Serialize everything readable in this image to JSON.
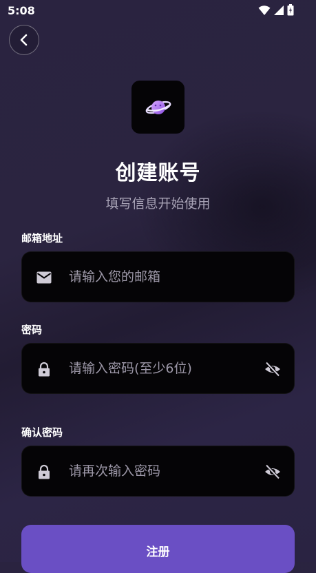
{
  "status_bar": {
    "time": "5:08"
  },
  "header": {
    "title": "创建账号",
    "subtitle": "填写信息开始使用"
  },
  "form": {
    "email": {
      "label": "邮箱地址",
      "placeholder": "请输入您的邮箱",
      "value": "",
      "icon": "mail-icon"
    },
    "password": {
      "label": "密码",
      "placeholder": "请输入密码(至少6位)",
      "value": "",
      "icon": "lock-icon",
      "toggle_icon": "eye-off-icon"
    },
    "confirm_password": {
      "label": "确认密码",
      "placeholder": "请再次输入密码",
      "value": "",
      "icon": "lock-icon",
      "toggle_icon": "eye-off-icon"
    }
  },
  "submit": {
    "label": "注册"
  },
  "colors": {
    "accent": "#6a4fc4",
    "field_bg": "#050406",
    "placeholder": "#9d98a8",
    "subtitle": "#a8a3b6"
  }
}
